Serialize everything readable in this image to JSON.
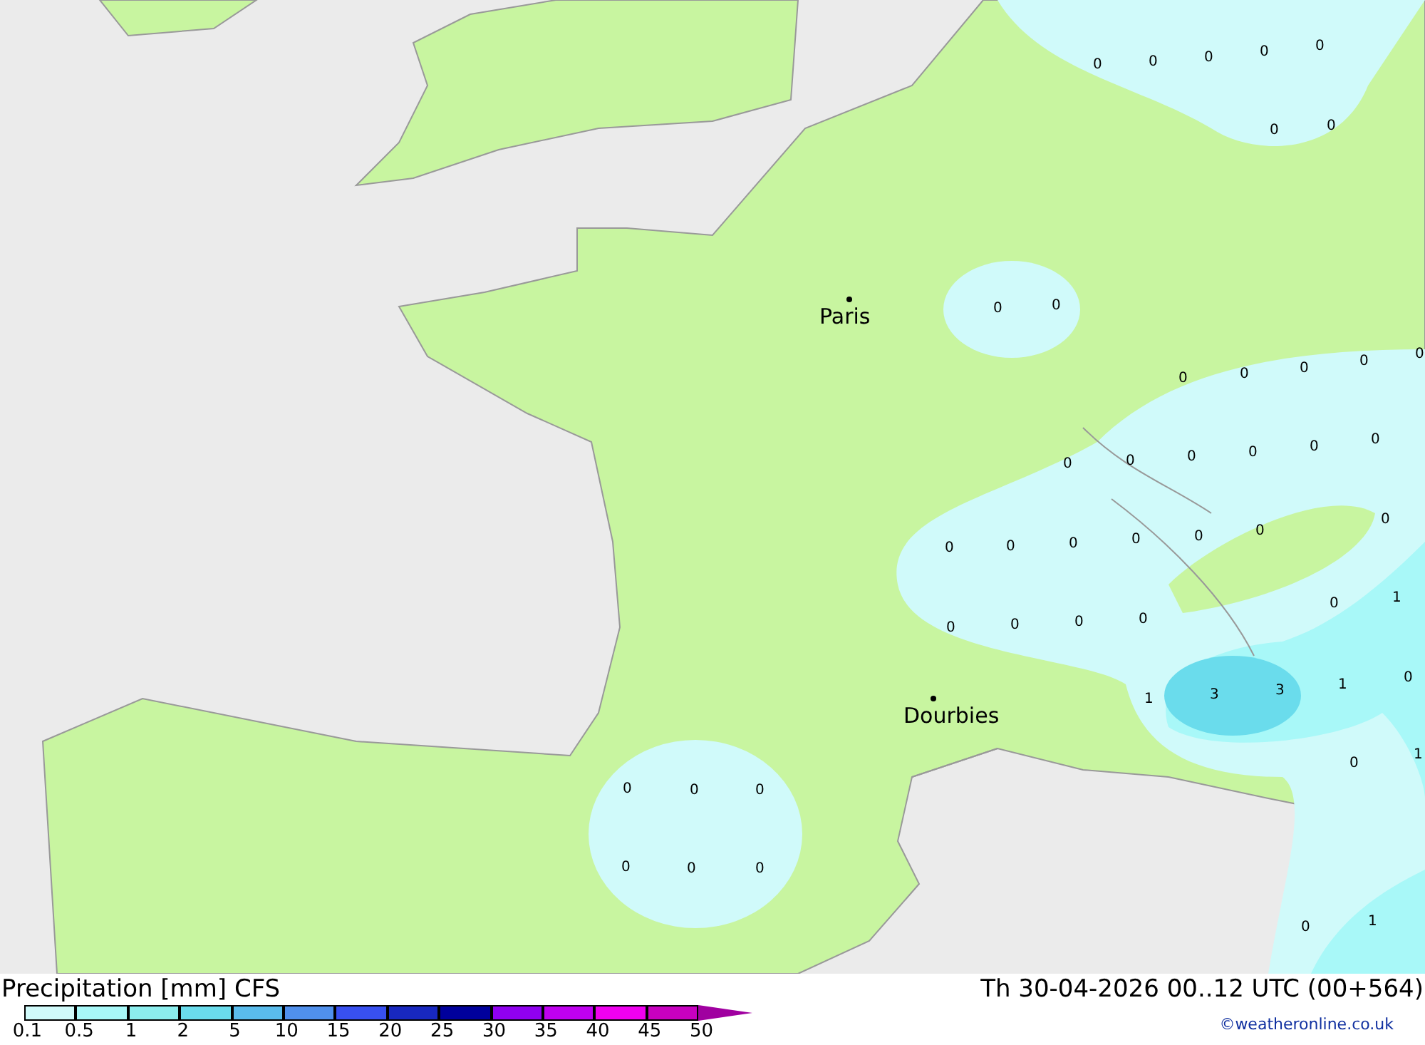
{
  "map": {
    "cities": [
      {
        "name": "Paris"
      },
      {
        "name": "Dourbies"
      }
    ],
    "values": [
      "0",
      "0",
      "0",
      "0",
      "0",
      "0",
      "0",
      "0",
      "0",
      "0",
      "0",
      "0",
      "0",
      "0",
      "0",
      "0",
      "0",
      "0",
      "0",
      "0",
      "0",
      "0",
      "0",
      "0",
      "0",
      "0",
      "0",
      "0",
      "0",
      "0",
      "0",
      "1",
      "1",
      "3",
      "3",
      "1",
      "0",
      "0",
      "0",
      "0",
      "0",
      "0",
      "0",
      "0",
      "0",
      "0",
      "1",
      "1"
    ]
  },
  "legend": {
    "title": "Precipitation [mm] CFS",
    "date": "Th 30-04-2026 00..12 UTC (00+564)",
    "segments": [
      {
        "color": "#d0fafa"
      },
      {
        "color": "#a8f8f8"
      },
      {
        "color": "#8ceeee"
      },
      {
        "color": "#6adcec"
      },
      {
        "color": "#5abcec"
      },
      {
        "color": "#5090ec"
      },
      {
        "color": "#3850f0"
      },
      {
        "color": "#1828c0"
      },
      {
        "color": "#00009c"
      },
      {
        "color": "#9000f0"
      },
      {
        "color": "#c000f0"
      },
      {
        "color": "#f000f0"
      },
      {
        "color": "#c800c0"
      }
    ],
    "ticks": [
      "0.1",
      "0.5",
      "1",
      "2",
      "5",
      "10",
      "15",
      "20",
      "25",
      "30",
      "35",
      "40",
      "45",
      "50"
    ],
    "copyright": "©weatheronline.co.uk"
  }
}
